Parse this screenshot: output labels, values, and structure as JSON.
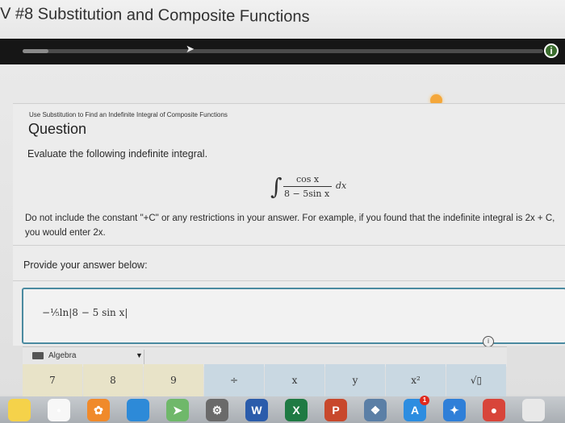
{
  "page": {
    "title": "V #8 Substitution and Composite Functions"
  },
  "navbar": {
    "progress_fraction": 0.05,
    "info_icon": "info-icon"
  },
  "question": {
    "subtitle": "Use Substitution to Find an Indefinite Integral of Composite Functions",
    "heading": "Question",
    "prompt": "Evaluate the following indefinite integral.",
    "integral": {
      "sign": "∫",
      "numerator": "cos x",
      "denominator": "8 − 5sin x",
      "differential": "dx"
    },
    "instruction": "Do not include the constant \"+C\" or any restrictions in your answer. For example, if you found that the indefinite integral is 2x + C, you would enter 2x."
  },
  "answer": {
    "prompt": "Provide your answer below:",
    "value": "−⅕ln|8 − 5 sin x|"
  },
  "keyboard": {
    "mode_label": "Algebra",
    "keys": [
      {
        "label": "7",
        "kind": "num"
      },
      {
        "label": "8",
        "kind": "num"
      },
      {
        "label": "9",
        "kind": "num"
      },
      {
        "label": "÷",
        "kind": "op"
      },
      {
        "label": "x",
        "kind": "op"
      },
      {
        "label": "y",
        "kind": "op"
      },
      {
        "label": "x²",
        "kind": "op"
      },
      {
        "label": "√▯",
        "kind": "op"
      }
    ]
  },
  "dock": {
    "apps": [
      {
        "name": "notes",
        "glyph": "",
        "color": "#f5d24a"
      },
      {
        "name": "reminders",
        "glyph": "•",
        "color": "#f7f7f7"
      },
      {
        "name": "photos",
        "glyph": "✿",
        "color": "#f08a2b"
      },
      {
        "name": "safari-blue",
        "glyph": "",
        "color": "#2d8ad8"
      },
      {
        "name": "maps",
        "glyph": "➤",
        "color": "#6fb86a"
      },
      {
        "name": "system-preferences",
        "glyph": "⚙",
        "color": "#6a6a6a"
      },
      {
        "name": "word",
        "glyph": "W",
        "color": "#2b5cab"
      },
      {
        "name": "excel",
        "glyph": "X",
        "color": "#1f7a43"
      },
      {
        "name": "powerpoint",
        "glyph": "P",
        "color": "#c8482c"
      },
      {
        "name": "preview",
        "glyph": "❖",
        "color": "#5b7fa6"
      },
      {
        "name": "app-store",
        "glyph": "A",
        "color": "#2d8de0",
        "badge": "1"
      },
      {
        "name": "safari",
        "glyph": "✦",
        "color": "#2f7fd8"
      },
      {
        "name": "chrome",
        "glyph": "●",
        "color": "#d8453a"
      },
      {
        "name": "extra",
        "glyph": "",
        "color": "#e8e8e8"
      }
    ]
  }
}
